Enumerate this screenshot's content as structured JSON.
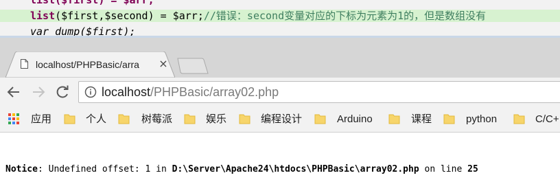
{
  "editor": {
    "line_1_text": "list($first) = $arr;",
    "line_2_keyword": "list",
    "line_2_code": "($first,$second) = $arr;",
    "line_2_comment": "//错误：second变量对应的下标为元素为1的，但是数组没有",
    "line_3_text": "var_dump($first);"
  },
  "browser": {
    "tab_title": "localhost/PHPBasic/arra",
    "tab_close": "×",
    "url_host": "localhost",
    "url_path": "/PHPBasic/array02.php",
    "bookmarks": [
      {
        "label": "应用",
        "icon": "apps-grid-icon"
      },
      {
        "label": "个人",
        "icon": "folder-icon"
      },
      {
        "label": "树莓派",
        "icon": "folder-icon"
      },
      {
        "label": "娱乐",
        "icon": "folder-icon"
      },
      {
        "label": "编程设计",
        "icon": "folder-icon"
      },
      {
        "label": "Arduino",
        "icon": "folder-icon"
      },
      {
        "label": "课程",
        "icon": "folder-icon"
      },
      {
        "label": "python",
        "icon": "folder-icon"
      },
      {
        "label": "C/C+",
        "icon": "folder-icon"
      }
    ]
  },
  "page": {
    "notice_label": "Notice",
    "notice_colon": ":  Undefined offset: 1 in ",
    "notice_path": "D:\\Server\\Apache24\\htdocs\\PHPBasic\\array02.php",
    "notice_on_line": " on line ",
    "notice_line_number": "25"
  },
  "colors": {
    "keyword": "#7f0055",
    "comment": "#3f7f5f",
    "highlight_line": "#d7f2d0",
    "folder": "#f7d56b"
  }
}
